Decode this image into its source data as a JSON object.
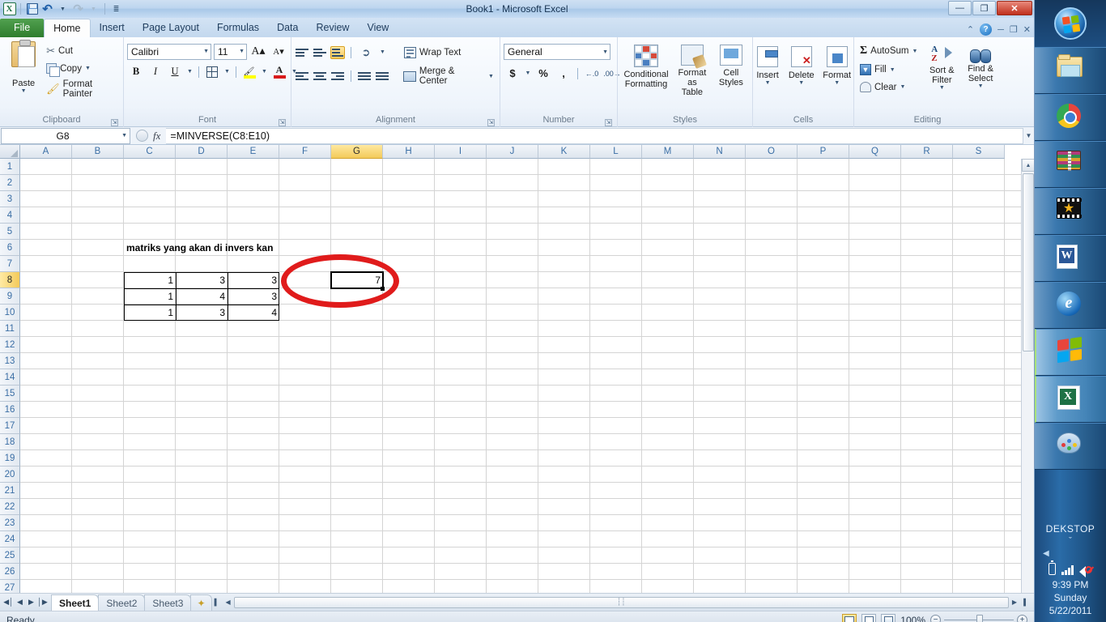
{
  "window": {
    "title": "Book1  -  Microsoft Excel",
    "quick_access": [
      "save-icon",
      "undo-icon",
      "redo-icon",
      "customize-qat-icon"
    ],
    "controls": {
      "minimize": "—",
      "restore": "❐",
      "close": "✕"
    },
    "ribbon_controls": {
      "minimize_ribbon": "⌃",
      "help": "?",
      "restore_window": "❐",
      "close_window": "✕"
    }
  },
  "tabs": {
    "file": "File",
    "items": [
      "Home",
      "Insert",
      "Page Layout",
      "Formulas",
      "Data",
      "Review",
      "View"
    ],
    "active": "Home"
  },
  "ribbon": {
    "clipboard": {
      "label": "Clipboard",
      "paste": "Paste",
      "cut": "Cut",
      "copy": "Copy",
      "format_painter": "Format Painter"
    },
    "font": {
      "label": "Font",
      "font_name": "Calibri",
      "font_size": "11",
      "grow_font": "A",
      "shrink_font": "A",
      "bold": "B",
      "italic": "I",
      "underline": "U",
      "borders": "borders-icon",
      "fill_color": "fill-color-icon",
      "font_color": "A"
    },
    "alignment": {
      "label": "Alignment",
      "top_align": "top-align-icon",
      "middle_align": "middle-align-icon",
      "bottom_align": "bottom-align-icon",
      "orientation": "orientation-icon",
      "align_left": "align-left-icon",
      "align_center": "align-center-icon",
      "align_right": "align-right-icon",
      "decrease_indent": "decrease-indent-icon",
      "increase_indent": "increase-indent-icon",
      "wrap_text": "Wrap Text",
      "merge_center": "Merge & Center"
    },
    "number": {
      "label": "Number",
      "format": "General",
      "accounting": "$",
      "percent": "%",
      "comma": ",",
      "increase_decimal": ".00",
      "decrease_decimal": ".00"
    },
    "styles": {
      "label": "Styles",
      "conditional_formatting": "Conditional Formatting",
      "format_as_table": "Format as Table",
      "cell_styles": "Cell Styles"
    },
    "cells": {
      "label": "Cells",
      "insert": "Insert",
      "delete": "Delete",
      "format": "Format"
    },
    "editing": {
      "label": "Editing",
      "autosum": "AutoSum",
      "fill": "Fill",
      "clear": "Clear",
      "sort_filter": "Sort & Filter",
      "find_select": "Find & Select"
    }
  },
  "formula_bar": {
    "name_box": "G8",
    "fx_label": "fx",
    "formula": "=MINVERSE(C8:E10)"
  },
  "grid": {
    "columns": [
      "A",
      "B",
      "C",
      "D",
      "E",
      "F",
      "G",
      "H",
      "I",
      "J",
      "K",
      "L",
      "M",
      "N",
      "O",
      "P",
      "Q",
      "R",
      "S"
    ],
    "selected_column": "G",
    "rows": [
      1,
      2,
      3,
      4,
      5,
      6,
      7,
      8,
      9,
      10,
      11,
      12,
      13,
      14,
      15,
      16,
      17,
      18,
      19,
      20,
      21,
      22,
      23,
      24,
      25,
      26,
      27
    ],
    "selected_row": 8,
    "selected_cell": "G8",
    "cells": [
      {
        "ref": "C6",
        "col": 2,
        "row": 6,
        "value": "matriks yang akan di invers kan",
        "style": "bold"
      },
      {
        "ref": "C8",
        "col": 2,
        "row": 8,
        "value": "1",
        "style": "num"
      },
      {
        "ref": "D8",
        "col": 3,
        "row": 8,
        "value": "3",
        "style": "num"
      },
      {
        "ref": "E8",
        "col": 4,
        "row": 8,
        "value": "3",
        "style": "num"
      },
      {
        "ref": "C9",
        "col": 2,
        "row": 9,
        "value": "1",
        "style": "num"
      },
      {
        "ref": "D9",
        "col": 3,
        "row": 9,
        "value": "4",
        "style": "num"
      },
      {
        "ref": "E9",
        "col": 4,
        "row": 9,
        "value": "3",
        "style": "num"
      },
      {
        "ref": "C10",
        "col": 2,
        "row": 10,
        "value": "1",
        "style": "num"
      },
      {
        "ref": "D10",
        "col": 3,
        "row": 10,
        "value": "3",
        "style": "num"
      },
      {
        "ref": "E10",
        "col": 4,
        "row": 10,
        "value": "4",
        "style": "num"
      },
      {
        "ref": "G8",
        "col": 6,
        "row": 8,
        "value": "7",
        "style": "num"
      }
    ],
    "annotation": {
      "type": "red-ellipse",
      "color": "#e01b1b",
      "target": "G8"
    }
  },
  "sheet_tabs": {
    "items": [
      "Sheet1",
      "Sheet2",
      "Sheet3"
    ],
    "active": "Sheet1",
    "insert_sheet": "insert-worksheet-icon",
    "nav": [
      "⏮",
      "◀",
      "▶",
      "⏭"
    ]
  },
  "status_bar": {
    "status": "Ready",
    "views": [
      "normal-view-icon",
      "page-layout-view-icon",
      "page-break-view-icon"
    ],
    "zoom": "100%",
    "zoom_out": "−",
    "zoom_in": "+"
  },
  "taskbar": {
    "start": "start-orb-icon",
    "items": [
      {
        "name": "windows-explorer-icon",
        "icon": "folder"
      },
      {
        "name": "google-chrome-icon",
        "icon": "chrome"
      },
      {
        "name": "winrar-icon",
        "icon": "winrar"
      },
      {
        "name": "media-player-icon",
        "icon": "movie"
      },
      {
        "name": "microsoft-word-icon",
        "icon": "word"
      },
      {
        "name": "internet-explorer-icon",
        "icon": "ie"
      },
      {
        "name": "windows-icon",
        "icon": "winflag"
      },
      {
        "name": "microsoft-excel-icon",
        "icon": "excel"
      },
      {
        "name": "paint-icon",
        "icon": "paint"
      }
    ],
    "tray": {
      "host": "DEKSTOP",
      "show_hidden": "ˇ",
      "collapse": "◀",
      "battery": "battery-icon",
      "network": "network-signal-icon",
      "volume": "volume-muted-icon",
      "time": "9:39 PM",
      "day": "Sunday",
      "date": "5/22/2011"
    }
  }
}
